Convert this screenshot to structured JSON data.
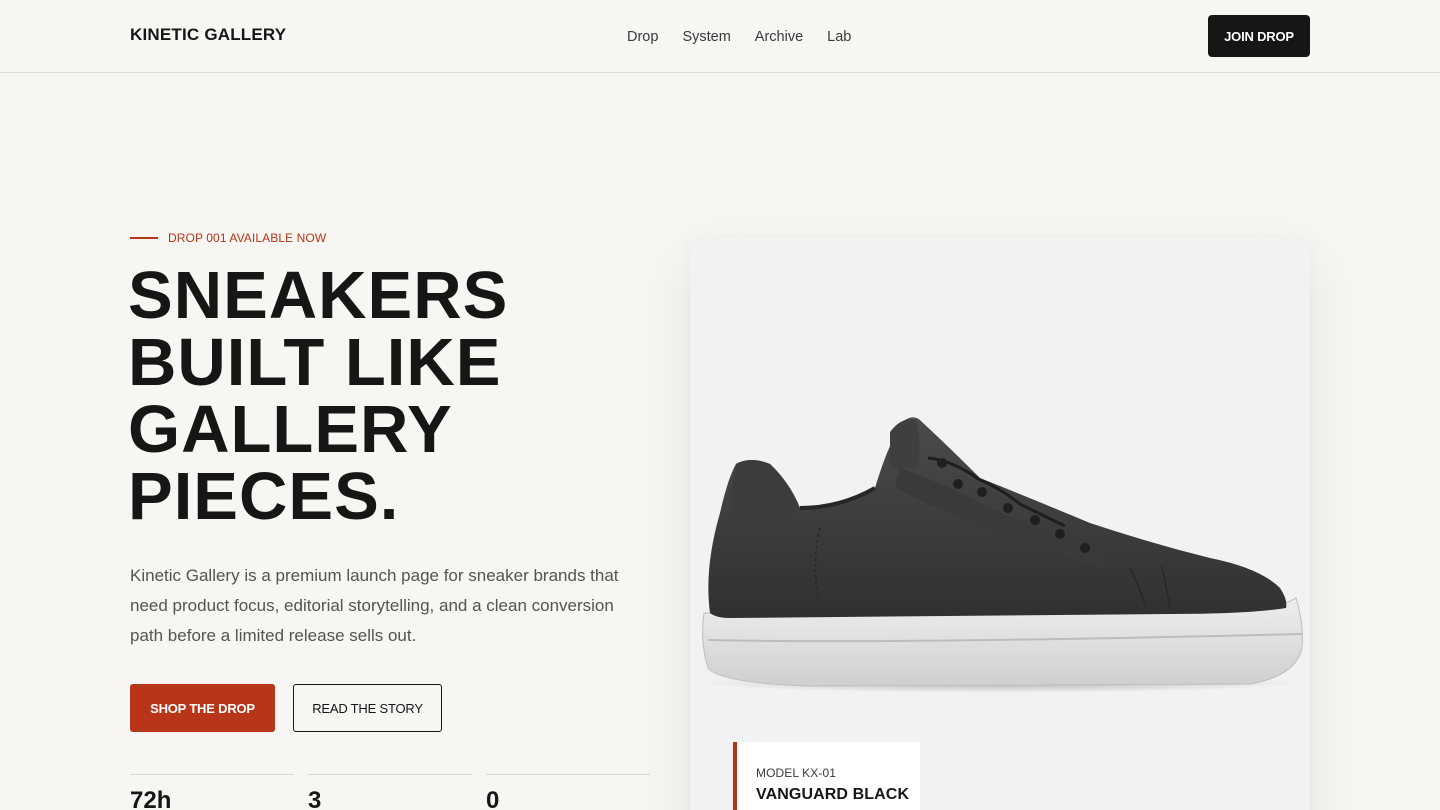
{
  "header": {
    "logo": "KINETIC GALLERY",
    "nav": [
      "Drop",
      "System",
      "Archive",
      "Lab"
    ],
    "cta_label": "JOIN DROP"
  },
  "hero": {
    "eyebrow": "DROP 001 AVAILABLE NOW",
    "headline_lines": [
      "SNEAKERS",
      "BUILT LIKE",
      "GALLERY",
      "PIECES."
    ],
    "description": "Kinetic Gallery is a premium launch page for sneaker brands that need product focus, editorial storytelling, and a clean conversion path before a limited release sells out.",
    "primary_cta": "SHOP THE DROP",
    "secondary_cta": "READ THE STORY",
    "stats": [
      "72h",
      "3",
      "0"
    ]
  },
  "product": {
    "model_code": "MODEL KX-01",
    "model_name": "VANGUARD BLACK"
  },
  "colors": {
    "accent": "#b8351a",
    "ink": "#161616",
    "background": "#f7f6f2",
    "card": "#f1f2f3"
  }
}
